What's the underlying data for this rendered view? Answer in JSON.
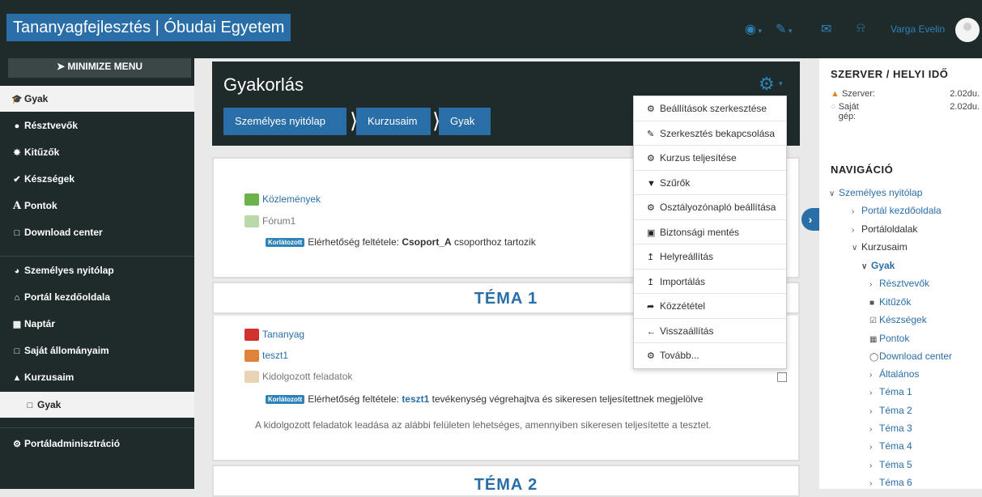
{
  "topbar": {
    "site_name": "Tananyagfejlesztés | Óbudai Egyetem",
    "user_name": "Varga Evelin",
    "icons": [
      "globe-icon",
      "paint-brush-icon",
      "envelope-icon",
      "bell-icon"
    ]
  },
  "left_nav": {
    "minimize_label": "MINIMIZE MENU",
    "items": [
      {
        "label": "Gyak",
        "icon": "graduation-cap-icon",
        "active": true
      },
      {
        "label": "Résztvevők",
        "icon": "users-icon"
      },
      {
        "label": "Kitűzők",
        "icon": "badge-icon"
      },
      {
        "label": "Készségek",
        "icon": "check-circle-icon"
      },
      {
        "label": "Pontok",
        "icon": "grades-icon"
      },
      {
        "label": "Download center",
        "icon": "folder-icon"
      },
      {
        "label": "Személyes nyitólap",
        "icon": "dashboard-icon"
      },
      {
        "label": "Portál kezdőoldala",
        "icon": "home-icon"
      },
      {
        "label": "Naptár",
        "icon": "calendar-icon"
      },
      {
        "label": "Saját állományaim",
        "icon": "folder-icon"
      },
      {
        "label": "Kurzusaim",
        "icon": "sitemap-icon"
      },
      {
        "label": "Gyak",
        "icon": "folder-icon",
        "active": true
      },
      {
        "label": "Portáladminisztráció",
        "icon": "cogs-icon"
      }
    ]
  },
  "header": {
    "title": "Gyakorlás",
    "breadcrumb": [
      "Személyes nyitólap",
      "Kurzusaim",
      "Gyak"
    ]
  },
  "section0": {
    "activities": [
      "Közlemények",
      "Fórum1"
    ],
    "badge": "Korlátozott",
    "cond_prefix": "Elérhetőség feltétele:",
    "cond_group": "Csoport_A",
    "cond_suffix": "csoporthoz tartozik"
  },
  "topic1": {
    "title": "TÉMA 1",
    "activities": [
      "Tananyag",
      "teszt1",
      "Kidolgozott feladatok"
    ],
    "badge": "Korlátozott",
    "cond_prefix": "Elérhetőség feltétele:",
    "cond_link": "teszt1",
    "cond_suffix": "tevékenység végrehajtva és sikeresen teljesítettnek megjelölve",
    "note": "A kidolgozott feladatok leadása az alábbi felületen lehetséges, amennyiben sikeresen teljesítette a tesztet."
  },
  "topic2": {
    "title": "TÉMA 2"
  },
  "settings_menu": [
    {
      "label": "Beállítások szerkesztése",
      "icon": "cog-icon"
    },
    {
      "label": "Szerkesztés bekapcsolása",
      "icon": "pencil-icon"
    },
    {
      "label": "Kurzus teljesítése",
      "icon": "cog-icon"
    },
    {
      "label": "Szűrők",
      "icon": "filter-icon"
    },
    {
      "label": "Osztályozónapló beállítása",
      "icon": "cog-icon"
    },
    {
      "label": "Biztonsági mentés",
      "icon": "file-icon"
    },
    {
      "label": "Helyreállítás",
      "icon": "upload-icon"
    },
    {
      "label": "Importálás",
      "icon": "upload-icon"
    },
    {
      "label": "Közzététel",
      "icon": "share-icon"
    },
    {
      "label": "Visszaállítás",
      "icon": "arrow-left-icon"
    },
    {
      "label": "Tovább...",
      "icon": "cog-icon"
    }
  ],
  "server_time": {
    "title": "SZERVER / HELYI IDŐ",
    "server_label": "Szerver:",
    "server_value": "2.02du.",
    "local_label": "Saját gép:",
    "local_value": "2.02du."
  },
  "navigation": {
    "title": "NAVIGÁCIÓ",
    "nodes": [
      "Személyes nyitólap",
      "Portál kezdőoldala",
      "Portáloldalak",
      "Kurzusaim",
      "Gyak",
      "Résztvevők",
      "Kitűzők",
      "Készségek",
      "Pontok",
      "Download center",
      "Általános",
      "Téma 1",
      "Téma 2",
      "Téma 3",
      "Téma 4",
      "Téma 5",
      "Téma 6"
    ]
  }
}
